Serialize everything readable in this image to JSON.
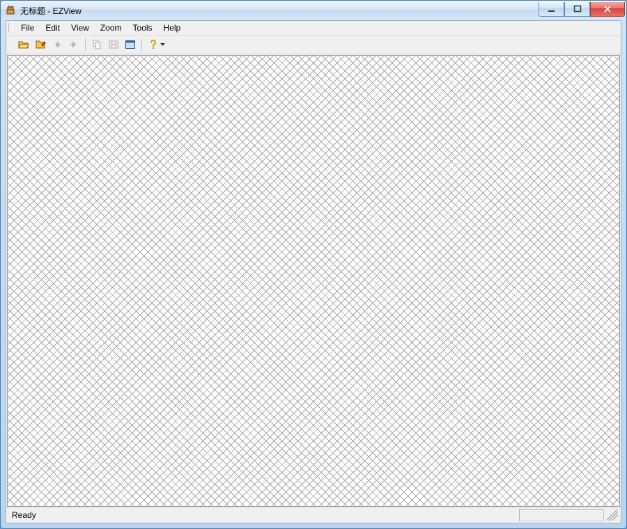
{
  "window": {
    "title": "无标题 - EZView"
  },
  "menus": {
    "file": "File",
    "edit": "Edit",
    "view": "View",
    "zoom": "Zoom",
    "tools": "Tools",
    "help": "Help"
  },
  "toolbar_icons": {
    "open": "open-folder-icon",
    "album": "album-icon",
    "back": "back-arrow-icon",
    "forward": "forward-arrow-icon",
    "copy": "copy-icon",
    "fit": "fit-window-icon",
    "fullscreen": "fullscreen-icon",
    "help": "help-icon"
  },
  "status": {
    "text": "Ready"
  }
}
